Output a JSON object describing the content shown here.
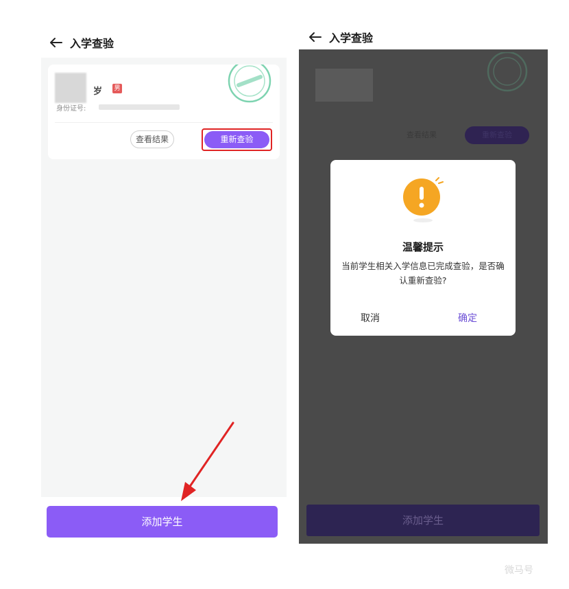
{
  "left": {
    "header": {
      "title": "入学查验"
    },
    "card": {
      "age_suffix": "岁",
      "gender_badge": "男",
      "id_label": "身份证号:",
      "view_result_label": "查看结果",
      "recheck_label": "重新查验"
    },
    "add_student_label": "添加学生"
  },
  "right": {
    "header": {
      "title": "入学查验"
    },
    "card": {
      "view_result_label": "查看结果",
      "recheck_label": "重新查验"
    },
    "dialog": {
      "title": "温馨提示",
      "message": "当前学生相关入学信息已完成查验，是否确认重新查验?",
      "cancel_label": "取消",
      "confirm_label": "确定"
    },
    "add_student_label": "添加学生"
  },
  "colors": {
    "accent": "#8b5cf6",
    "highlight_border": "#e02424",
    "warning": "#f5a623",
    "confirm_text": "#6c4fd6"
  },
  "icons": [
    "back-arrow-icon",
    "stamp-icon",
    "warning-icon",
    "annotation-arrow-icon"
  ],
  "watermark": "微马号"
}
